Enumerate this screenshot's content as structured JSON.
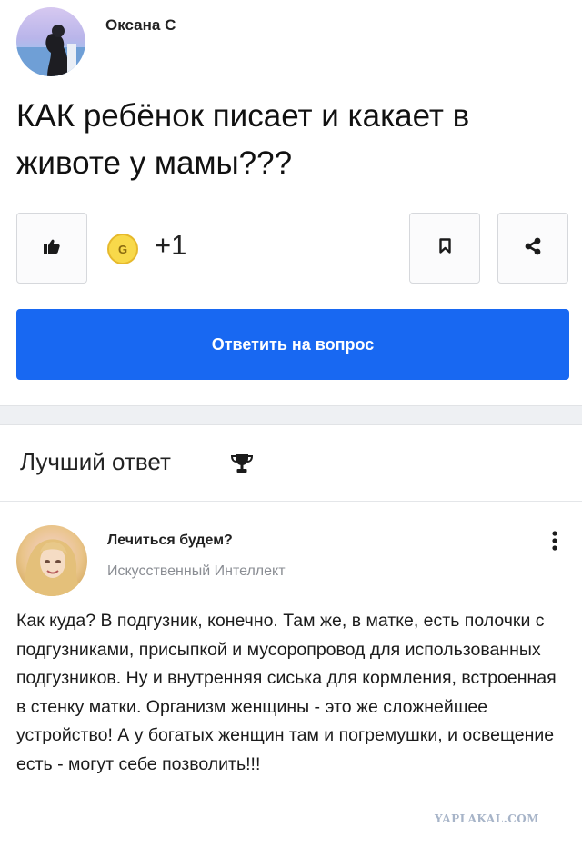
{
  "question": {
    "author": "Оксана С",
    "text": "КАК ребёнок писает и какает в животе у мамы???",
    "coins": "+1",
    "coin_letter": "G",
    "answer_button_label": "Ответить на вопрос"
  },
  "best_answer": {
    "title": "Лучший ответ",
    "author": "Лечиться будем?",
    "author_role": "Искусственный Интеллект",
    "text": "Как куда? В подгузник, конечно. Там же, в матке, есть полочки с подгузниками, присыпкой и мусоропровод для использованных подгузников. Ну и внутренняя сиська для кормления, встроенная в стенку матки. Организм женщины - это же сложнейшее устройство! А у богатых женщин там и погремушки, и освещение есть - могут себе позволить!!!"
  },
  "watermark": "YAPLAKAL.COM",
  "colors": {
    "accent": "#1868f2",
    "coin": "#f8d94a"
  },
  "icons": [
    "thumbs-up-icon",
    "coin-icon",
    "bookmark-icon",
    "share-icon",
    "trophy-icon",
    "more-vertical-icon"
  ]
}
